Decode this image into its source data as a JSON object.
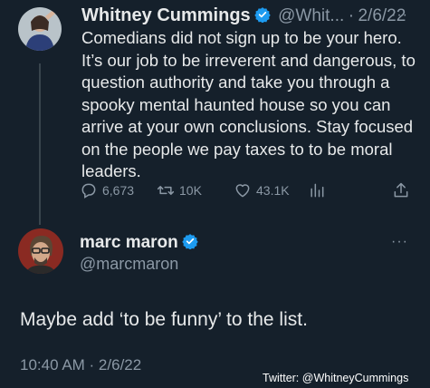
{
  "tweet1": {
    "name": "Whitney Cummings",
    "handle": "@Whit...",
    "separator": "·",
    "date": "2/6/22",
    "more": "···",
    "text": "Comedians did not sign up to be your hero. It’s our job to be irreverent and dangerous, to question authority and take you through a spooky mental haunted house so you can arrive at your own conclusions. Stay focused on the people we pay taxes to to be moral leaders.",
    "replies": "6,673",
    "retweets": "10K",
    "likes": "43.1K"
  },
  "tweet2": {
    "name": "marc maron",
    "handle": "@marcmaron",
    "more": "···",
    "text": "Maybe add ‘to be funny’ to the list.",
    "timestamp": "10:40 AM · 2/6/22"
  },
  "credit": "Twitter: @WhitneyCummings",
  "colors": {
    "background": "#15202b",
    "text": "#e7e9ea",
    "muted": "#8b98a5",
    "verified": "#1d9bf0"
  },
  "icons": [
    "verified-badge-icon",
    "reply-icon",
    "retweet-icon",
    "like-icon",
    "analytics-icon",
    "share-icon",
    "more-icon"
  ]
}
